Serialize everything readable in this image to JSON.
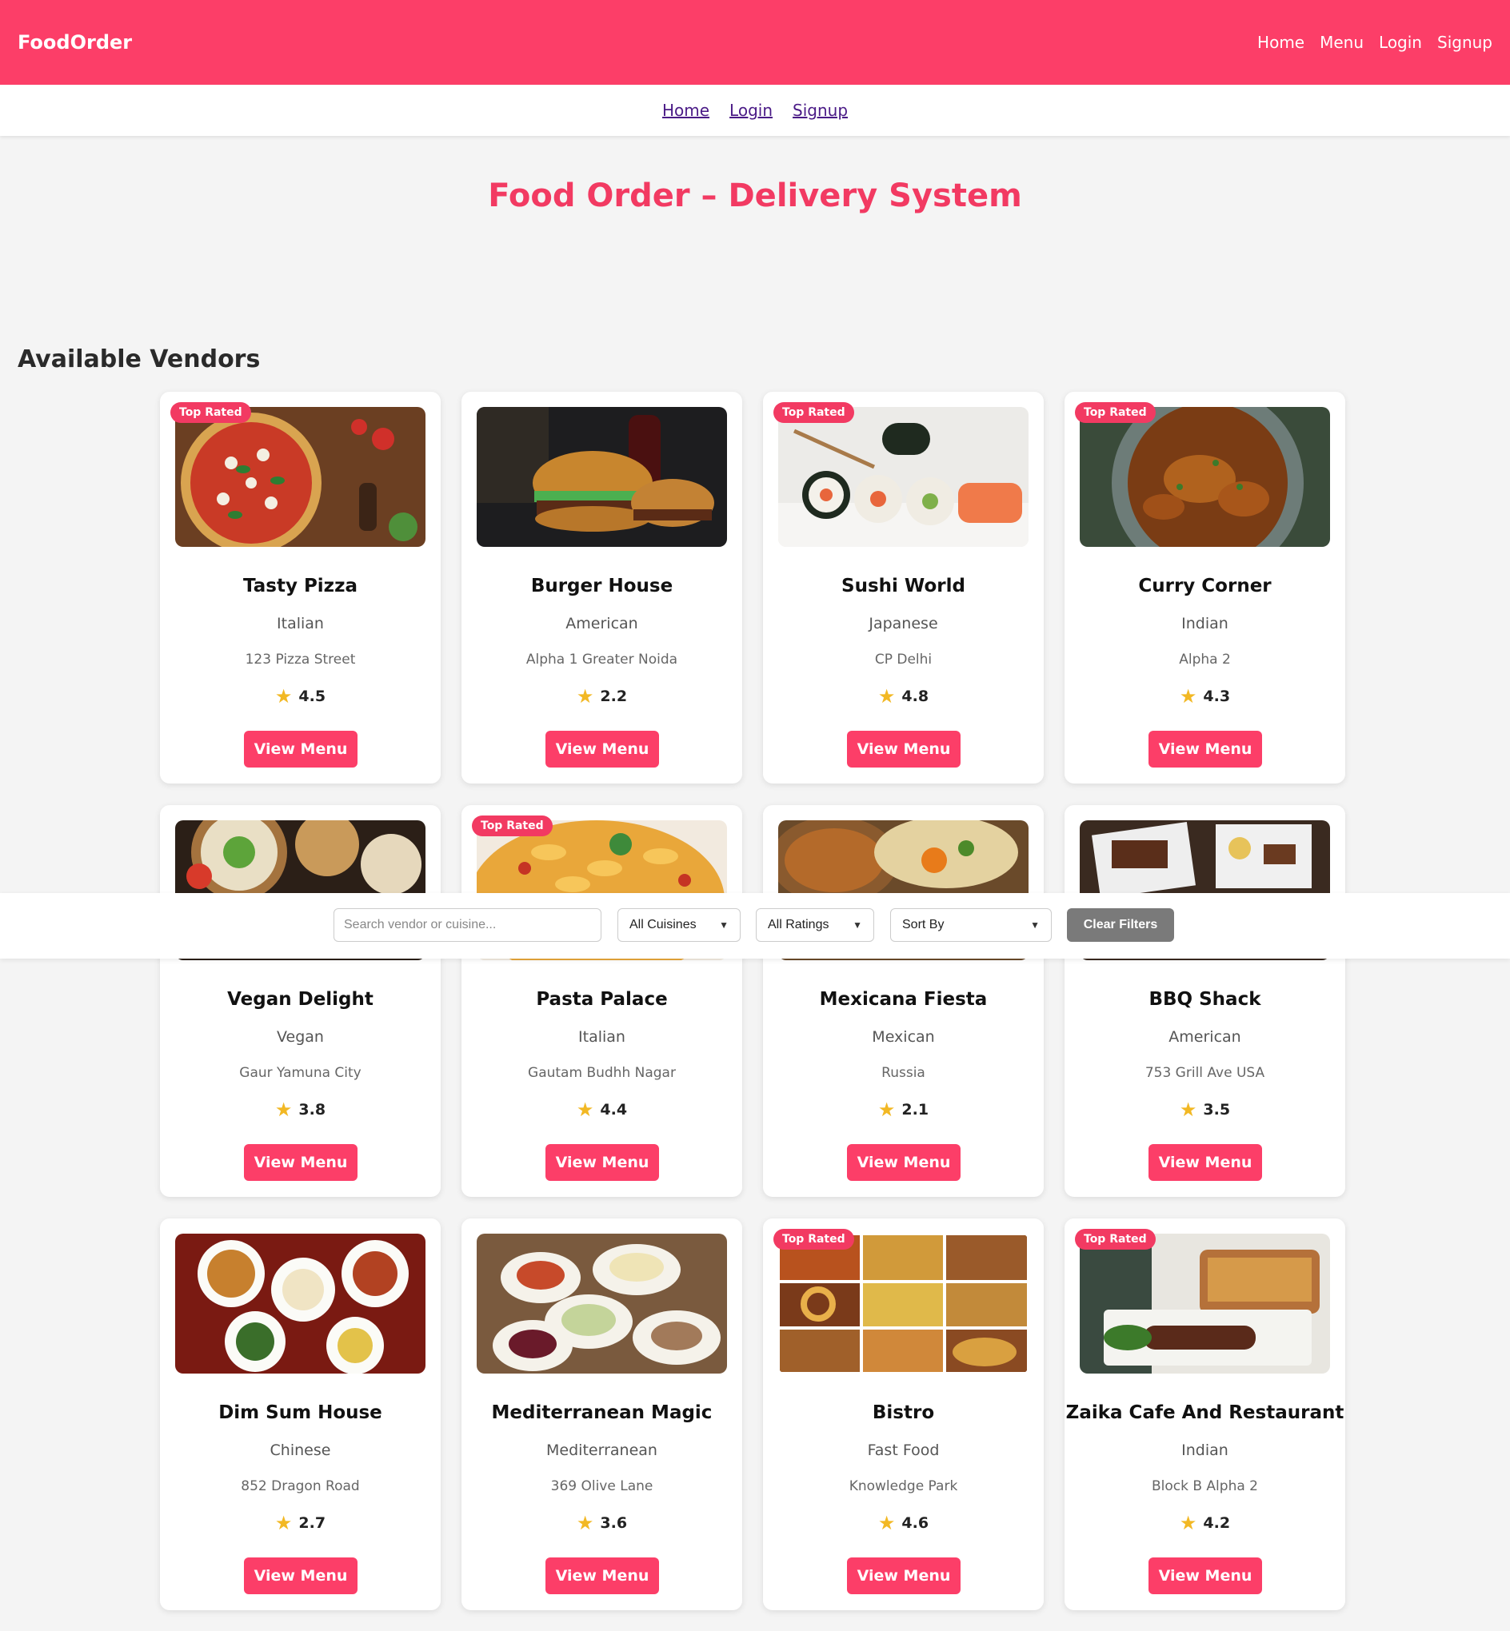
{
  "navbar": {
    "brand": "FoodOrder",
    "links": [
      "Home",
      "Menu",
      "Login",
      "Signup"
    ]
  },
  "subnav": {
    "links": [
      "Home",
      "Login",
      "Signup"
    ]
  },
  "page_title": "Food Order – Delivery System",
  "section_title": "Available Vendors",
  "filters": {
    "search_placeholder": "Search vendor or cuisine...",
    "cuisine": "All Cuisines",
    "ratings": "All Ratings",
    "sort": "Sort By",
    "clear": "Clear Filters"
  },
  "badge_label": "Top Rated",
  "button_label": "View Menu",
  "vendors": [
    {
      "name": "Tasty Pizza",
      "cuisine": "Italian",
      "address": "123 Pizza Street",
      "rating": "4.5",
      "top": true,
      "image": "pizza"
    },
    {
      "name": "Burger House",
      "cuisine": "American",
      "address": "Alpha 1 Greater Noida",
      "rating": "2.2",
      "top": false,
      "image": "burger"
    },
    {
      "name": "Sushi World",
      "cuisine": "Japanese",
      "address": "CP Delhi",
      "rating": "4.8",
      "top": true,
      "image": "sushi"
    },
    {
      "name": "Curry Corner",
      "cuisine": "Indian",
      "address": "Alpha 2",
      "rating": "4.3",
      "top": true,
      "image": "curry"
    },
    {
      "name": "Vegan Delight",
      "cuisine": "Vegan",
      "address": "Gaur Yamuna City",
      "rating": "3.8",
      "top": false,
      "image": "vegan"
    },
    {
      "name": "Pasta Palace",
      "cuisine": "Italian",
      "address": "Gautam Budhh Nagar",
      "rating": "4.4",
      "top": true,
      "image": "pasta"
    },
    {
      "name": "Mexicana Fiesta",
      "cuisine": "Mexican",
      "address": "Russia",
      "rating": "2.1",
      "top": false,
      "image": "mexican"
    },
    {
      "name": "BBQ Shack",
      "cuisine": "American",
      "address": "753 Grill Ave USA",
      "rating": "3.5",
      "top": false,
      "image": "bbq"
    },
    {
      "name": "Dim Sum House",
      "cuisine": "Chinese",
      "address": "852 Dragon Road",
      "rating": "2.7",
      "top": false,
      "image": "dimsum"
    },
    {
      "name": "Mediterranean Magic",
      "cuisine": "Mediterranean",
      "address": "369 Olive Lane",
      "rating": "3.6",
      "top": false,
      "image": "mezze"
    },
    {
      "name": "Bistro",
      "cuisine": "Fast Food",
      "address": "Knowledge Park",
      "rating": "4.6",
      "top": true,
      "image": "fastfood"
    },
    {
      "name": "Zaika Cafe And Restaurant",
      "cuisine": "Indian",
      "address": "Block B Alpha 2",
      "rating": "4.2",
      "top": true,
      "image": "zaika"
    }
  ],
  "colors": {
    "brand": "#fc3e68",
    "title": "#f23a62",
    "star": "#f2b824",
    "clear_button": "#7a7a7a"
  }
}
